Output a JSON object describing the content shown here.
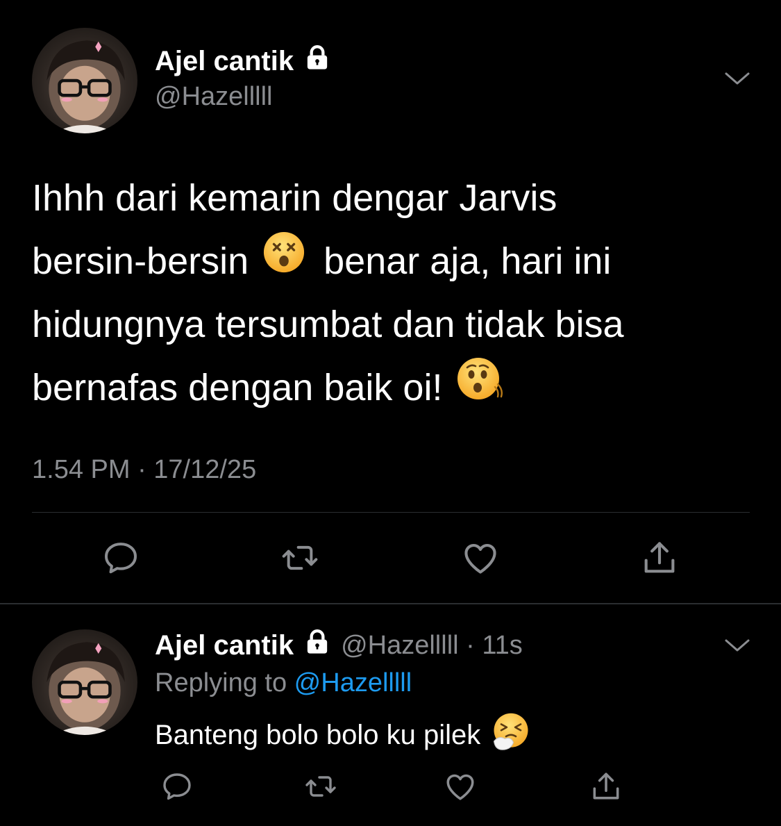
{
  "main_tweet": {
    "author": {
      "display_name": "Ajel cantik",
      "handle": "@Hazelllll",
      "protected_icon": "lock-icon"
    },
    "text_lines": [
      "Ihhh dari kemarin dengar Jarvis",
      "bersin-bersin",
      "benar aja, hari ini",
      "hidungnya tersumbat dan tidak bisa",
      "bernafas dengan baik oi!"
    ],
    "emojis": [
      "dizzy-face-emoji",
      "hushed-face-emoji"
    ],
    "timestamp": "1.54 PM · 17/12/25",
    "actions": [
      "reply-icon",
      "retweet-icon",
      "like-icon",
      "share-icon"
    ]
  },
  "reply_tweet": {
    "author": {
      "display_name": "Ajel cantik",
      "handle": "@Hazelllll",
      "protected_icon": "lock-icon"
    },
    "meta": "@Hazelllll · 11s",
    "replying_to_label": "Replying to ",
    "replying_to_handle": "@Hazelllll",
    "text": "Banteng bolo bolo ku pilek",
    "emoji": "sneezing-face-emoji",
    "actions": [
      "reply-icon",
      "retweet-icon",
      "like-icon",
      "share-icon"
    ]
  },
  "colors": {
    "background": "#000000",
    "text_primary": "#ffffff",
    "text_secondary": "#8b8d91",
    "mention": "#1d9bf0",
    "divider": "#2b2e31"
  }
}
